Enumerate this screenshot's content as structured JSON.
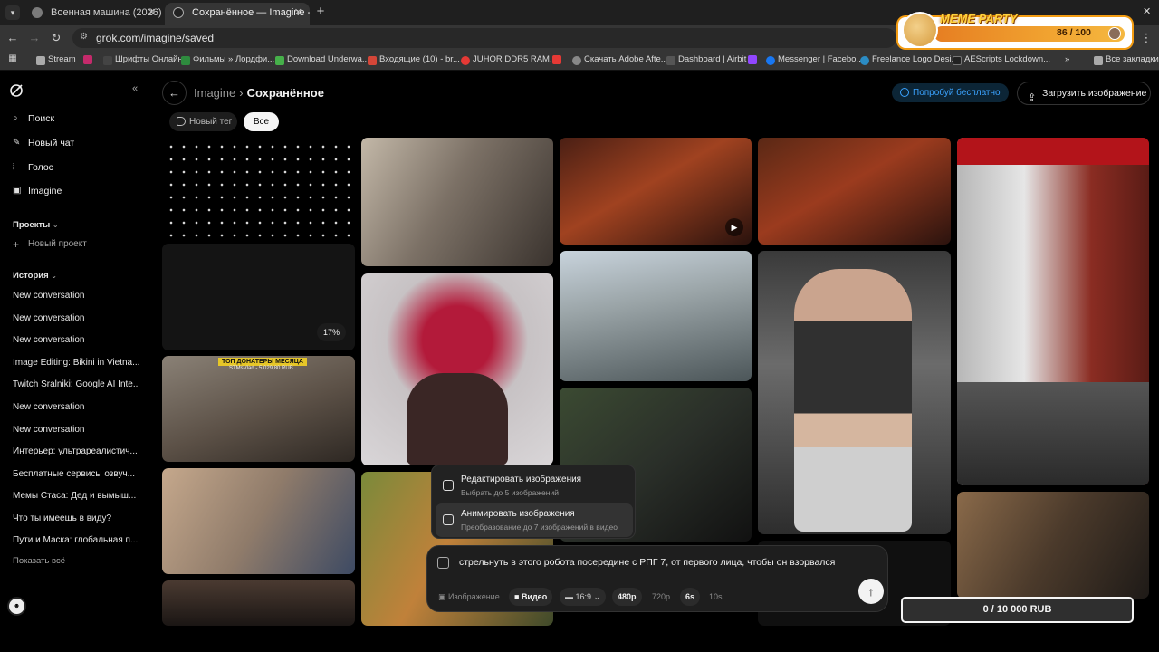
{
  "browser": {
    "tabs": [
      {
        "title": "Военная машина (2026)",
        "active": false
      },
      {
        "title": "Сохранённое — Imagine - Gro",
        "active": true
      }
    ],
    "url": "grok.com/imagine/saved",
    "bookmarks": [
      "Stream",
      "Шрифты Онлайн",
      "Фильмы » Лордфи...",
      "Download Underwa...",
      "Входящие (10) - br...",
      "JUHOR DDR5 RAM...",
      "Скачать Adobe Afte...",
      "Dashboard | Airbit",
      "Messenger | Facebo...",
      "Freelance Logo Desi...",
      "AEScripts Lockdown...",
      "Все закладки"
    ],
    "more_bookmarks": "»"
  },
  "meme_widget": {
    "title": "MEME PARTY",
    "count": "86 / 100",
    "progress_fraction": 0.86
  },
  "sidebar": {
    "nav": [
      {
        "label": "Поиск",
        "icon": "search-icon"
      },
      {
        "label": "Новый чат",
        "icon": "edit-icon"
      },
      {
        "label": "Голос",
        "icon": "voice-icon"
      },
      {
        "label": "Imagine",
        "icon": "image-icon"
      }
    ],
    "projects_title": "Проекты",
    "new_project": "Новый проект",
    "history_title": "История",
    "history": [
      "New conversation",
      "New conversation",
      "New conversation",
      "Image Editing: Bikini in Vietna...",
      "Twitch Sralniki: Google AI Inte...",
      "New conversation",
      "New conversation",
      "Интерьер: ультрареалистич...",
      "Бесплатные сервисы озвуч...",
      "Мемы Стаса: Дед и вымыш...",
      "Что ты имеешь в виду?",
      "Пути и Маска: глобальная п..."
    ],
    "show_all": "Показать всё"
  },
  "header": {
    "crumb_parent": "Imagine",
    "crumb_sep": "›",
    "crumb_current": "Сохранённое",
    "try_free": "Попробуй бесплатно",
    "upload": "Загрузить изображение"
  },
  "filters": {
    "new_tag": "Новый тег",
    "all": "Все"
  },
  "tiles": {
    "progress": "17%",
    "sticker_title": "ТОП ДОНАТЕРЫ МЕСЯЦА",
    "sticker_sub": "STMsVlad - 5 029,80 RUB"
  },
  "popover": {
    "items": [
      {
        "title": "Редактировать изображения",
        "sub": "Выбрать до 5 изображений"
      },
      {
        "title": "Анимировать изображения",
        "sub": "Преобразование до 7 изображений в видео"
      }
    ]
  },
  "composer": {
    "prompt": "стрельнуть в этого робота посередине с РПГ 7, от первого лица, чтобы он взорвался",
    "mode_image": "Изображение",
    "mode_video": "Видео",
    "ratio": "16:9",
    "res_480": "480p",
    "res_720": "720p",
    "dur_6": "6s",
    "dur_10": "10s"
  },
  "rub_box": "0 / 10 000 RUB",
  "colors": {
    "accent_blue": "#3ba3ff",
    "meme_orange": "#f39c12"
  }
}
